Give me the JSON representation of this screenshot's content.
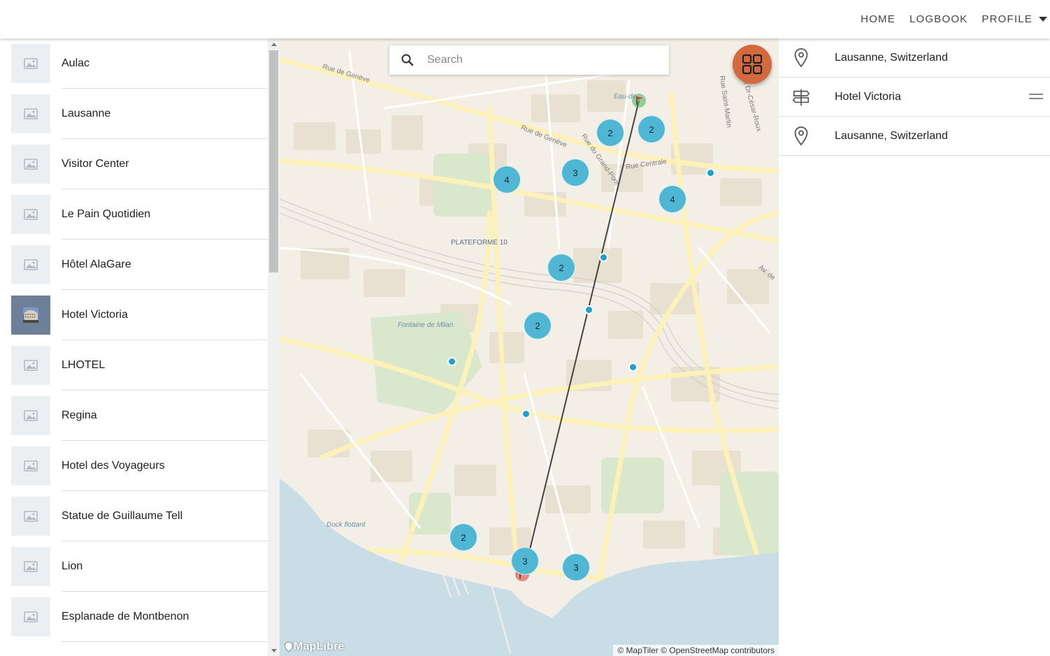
{
  "nav": {
    "home": "HOME",
    "logbook": "LOGBOOK",
    "profile": "PROFILE"
  },
  "places": [
    {
      "label": "Aulac",
      "image": "placeholder-image-icon"
    },
    {
      "label": "Lausanne",
      "image": "placeholder-image-icon"
    },
    {
      "label": "Visitor Center",
      "image": "placeholder-image-icon"
    },
    {
      "label": "Le Pain Quotidien",
      "image": "placeholder-image-icon"
    },
    {
      "label": "Hôtel AlaGare",
      "image": "placeholder-image-icon"
    },
    {
      "label": "Hotel Victoria",
      "image": "hotel-photo"
    },
    {
      "label": "LHOTEL",
      "image": "placeholder-image-icon"
    },
    {
      "label": "Regina",
      "image": "placeholder-image-icon"
    },
    {
      "label": "Hotel des Voyageurs",
      "image": "placeholder-image-icon"
    },
    {
      "label": "Statue de Guillaume Tell",
      "image": "placeholder-image-icon"
    },
    {
      "label": "Lion",
      "image": "placeholder-image-icon"
    },
    {
      "label": "Esplanade de Montbenon",
      "image": "placeholder-image-icon"
    }
  ],
  "map": {
    "search_placeholder": "Search",
    "labels": {
      "rue_de_geneve_1": "Rue de Genève",
      "rue_de_geneve_2": "Rue de Genève",
      "rue_du_grand_pont": "Rue du Grand-Pont",
      "rue_centrale": "Rue Centrale",
      "rue_saint_martin": "Rue Saint-Martin",
      "rue_dr_cesar_roux": "Rue Dr-César-Roux",
      "av_de": "Av. de",
      "eau_de": "Eau-de",
      "plateforme_10": "PLATEFORME 10",
      "fontaine_de_milan": "Fontaine de Milan",
      "dock_flottant": "Dock flottant"
    },
    "clusters": [
      "2",
      "2",
      "3",
      "4",
      "4",
      "2",
      "2",
      "2",
      "3",
      "3"
    ],
    "attribution": "© MapTiler © OpenStreetMap contributors",
    "logo": "MapLibre",
    "colors": {
      "cluster": "#4fb6d3",
      "point": "#1ea0cf",
      "fab": "#d2693f",
      "start_flag": "#3fae5a",
      "end_flag": "#e05a4f",
      "water": "#c8dde6",
      "park": "#d9e8cc"
    }
  },
  "route": [
    {
      "icon": "location-pin-icon",
      "label": "Lausanne, Switzerland"
    },
    {
      "icon": "signpost-icon",
      "label": "Hotel Victoria"
    },
    {
      "icon": "location-pin-icon",
      "label": "Lausanne, Switzerland"
    }
  ]
}
